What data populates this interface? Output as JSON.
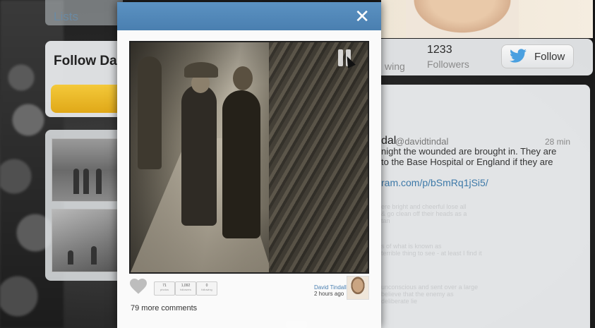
{
  "left": {
    "lists_label": "Lists",
    "follow_title": "Follow Da"
  },
  "profile": {
    "following_label": "wing",
    "followers_count": "1233",
    "followers_label": "Followers",
    "follow_button": "Follow"
  },
  "tweet": {
    "name_fragment": "dal",
    "handle": "@davidtindal",
    "time": "28 min",
    "lines": [
      "night the wounded are brought in. They are",
      "to the Base Hospital or England if they are"
    ],
    "link": "ram.com/p/bSmRq1jSi5/",
    "faded_lines": [
      "ere bright and cheerful lose all",
      "& go clean off their heads as a",
      "tan",
      "s of what is known as",
      "terrible thing to see - at least I find it",
      "unconscious and sent over a large",
      "believe that the enemy as",
      "deliberate lie"
    ]
  },
  "modal": {
    "close_symbol": "✕",
    "stats": [
      {
        "n": "71",
        "l": "photos"
      },
      {
        "n": "1,092",
        "l": "followers"
      },
      {
        "n": "0",
        "l": "following"
      }
    ],
    "author_name": "David Tindall",
    "author_time": "2 hours ago",
    "comments": "79 more comments"
  },
  "colors": {
    "header_blue": "#4a7fb0",
    "link_blue": "#3d79a8",
    "follow_yellow": "#f4c93a",
    "twitter_blue": "#4aa0e0"
  },
  "icons": [
    "close-icon",
    "heart-icon",
    "pause-icon",
    "cursor-icon",
    "twitter-bird-icon"
  ]
}
